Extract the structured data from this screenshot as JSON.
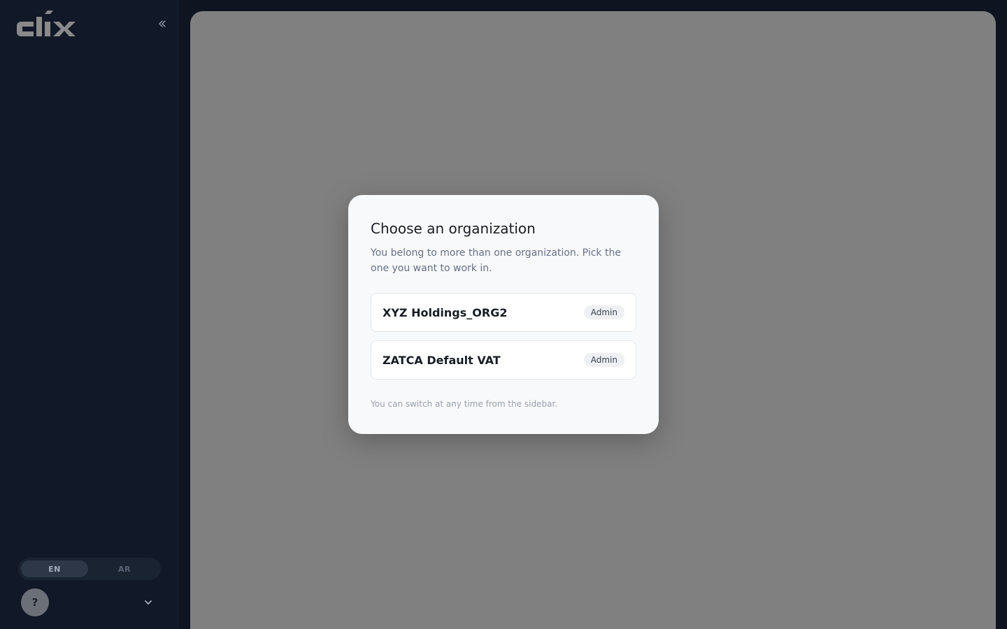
{
  "sidebar": {
    "logo_text": "clix",
    "collapse_icon": "double-chevron-left-icon",
    "language": {
      "options": [
        "EN",
        "AR"
      ],
      "selected": "EN"
    },
    "help_label": "?",
    "account_chevron_icon": "chevron-down-icon"
  },
  "modal": {
    "title": "Choose an organization",
    "description": "You belong to more than one organization. Pick the one you want to work in.",
    "organizations": [
      {
        "name": "XYZ Holdings_ORG2",
        "role": "Admin"
      },
      {
        "name": "ZATCA Default VAT",
        "role": "Admin"
      }
    ],
    "footer_note": "You can switch at any time from the sidebar."
  },
  "colors": {
    "sidebar_bg": "#111827",
    "overlay": "#808080",
    "modal_bg": "#f8f9fa"
  }
}
